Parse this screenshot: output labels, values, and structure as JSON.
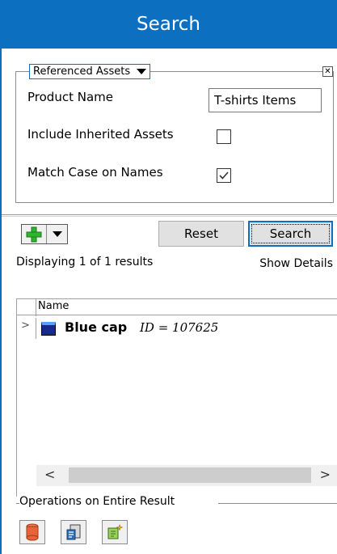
{
  "panel": {
    "title": "Search"
  },
  "criteria": {
    "group_label": "Referenced Assets",
    "close_glyph": "✕",
    "fields": {
      "product_name_label": "Product Name",
      "product_name_value": "T-shirts Items",
      "include_inherited_label": "Include Inherited Assets",
      "include_inherited_checked": false,
      "match_case_label": "Match Case on Names",
      "match_case_checked": true
    }
  },
  "toolbar": {
    "add_icon": "plus-icon",
    "reset_label": "Reset",
    "search_label": "Search"
  },
  "results": {
    "count_text": "Displaying 1 of 1 results",
    "show_details_label": "Show Details",
    "column_header": "Name",
    "rows": [
      {
        "expander": ">",
        "icon": "asset-icon",
        "name": "Blue cap",
        "id_text": "ID = 107625"
      }
    ]
  },
  "scrollbar": {
    "left_glyph": "<",
    "right_glyph": ">"
  },
  "operations": {
    "label": "Operations on Entire Result",
    "buttons": [
      {
        "icon": "database-icon"
      },
      {
        "icon": "export-icon"
      },
      {
        "icon": "wand-icon"
      }
    ]
  },
  "colors": {
    "accent": "#0d6fc0",
    "add_green": "#2db52d",
    "db_orange": "#e8633a"
  }
}
